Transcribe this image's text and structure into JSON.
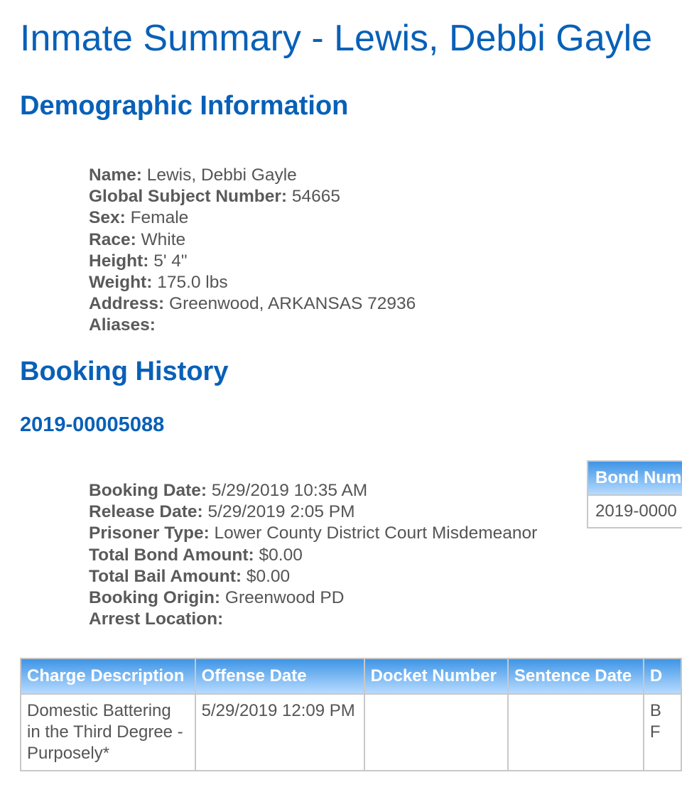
{
  "page": {
    "title": "Inmate Summary - Lewis, Debbi Gayle"
  },
  "demographics": {
    "heading": "Demographic Information",
    "fields": [
      {
        "label": "Name:",
        "value": "Lewis, Debbi Gayle"
      },
      {
        "label": "Global Subject Number:",
        "value": "54665"
      },
      {
        "label": "Sex:",
        "value": "Female"
      },
      {
        "label": "Race:",
        "value": "White"
      },
      {
        "label": "Height:",
        "value": "5' 4\""
      },
      {
        "label": "Weight:",
        "value": "175.0 lbs"
      },
      {
        "label": "Address:",
        "value": "Greenwood, ARKANSAS 72936"
      },
      {
        "label": "Aliases:",
        "value": ""
      }
    ]
  },
  "booking_history": {
    "heading": "Booking History",
    "booking_number": "2019-00005088",
    "fields": [
      {
        "label": "Booking Date:",
        "value": "5/29/2019 10:35 AM"
      },
      {
        "label": "Release Date:",
        "value": "5/29/2019 2:05 PM"
      },
      {
        "label": "Prisoner Type:",
        "value": "Lower County District Court Misdemeanor"
      },
      {
        "label": "Total Bond Amount:",
        "value": "$0.00"
      },
      {
        "label": "Total Bail Amount:",
        "value": "$0.00"
      },
      {
        "label": "Booking Origin:",
        "value": "Greenwood PD"
      },
      {
        "label": "Arrest Location:",
        "value": ""
      }
    ],
    "bond_table": {
      "header": "Bond Num",
      "cell": "2019-0000"
    },
    "charges_table": {
      "headers": [
        "Charge Description",
        "Offense Date",
        "Docket Number",
        "Sentence Date",
        "D"
      ],
      "rows": [
        [
          "Domestic Battering in the Third Degree - Purposely*",
          "5/29/2019 12:09 PM",
          "",
          "",
          "B\nF"
        ]
      ]
    }
  },
  "colors": {
    "heading_blue": "#0860b8",
    "table_header_top": "#3f95e6",
    "table_header_bottom": "#b7dbff"
  }
}
